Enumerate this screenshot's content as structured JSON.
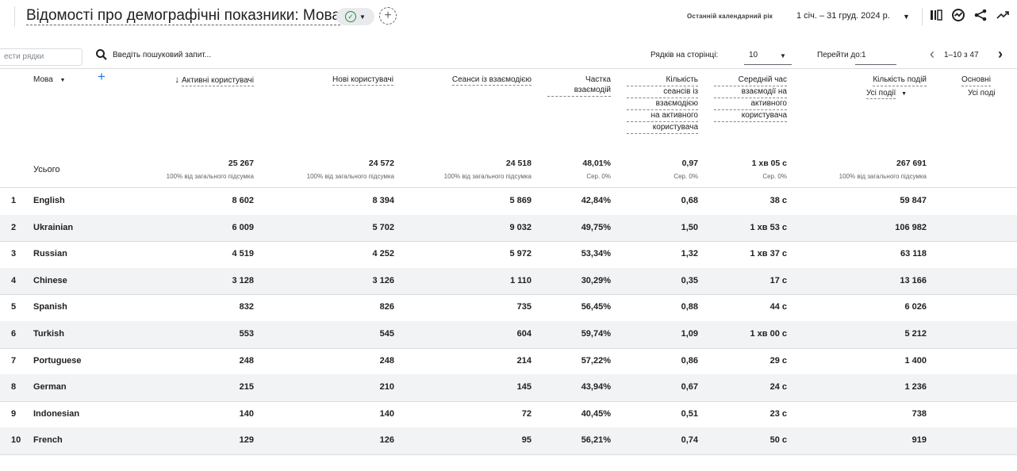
{
  "header": {
    "title": "Відомості про демографічні показники: Мова",
    "date_range_label": "Останній календарний рік",
    "date_range": "1 січ. – 31 груд. 2024 р."
  },
  "toolbar": {
    "filter_placeholder": "ести рядки",
    "search_placeholder": "Введіть пошуковий запит...",
    "rows_per_page_label": "Рядків на сторінці:",
    "rows_per_page_value": "10",
    "goto_label": "Перейти до:",
    "goto_value": "1",
    "pagination": "1–10 з 47"
  },
  "table": {
    "dimension_header": "Мова",
    "columns": [
      {
        "label": "Активні користувачі",
        "sorted": "desc"
      },
      {
        "label": "Нові користувачі"
      },
      {
        "label": "Сеанси із взаємодією"
      },
      {
        "label": "Частка взаємодій"
      },
      {
        "label": "Кількість сеансів із взаємодією на активного користувача"
      },
      {
        "label": "Середній час взаємодії на активного користувача"
      },
      {
        "label": "Кількість подій",
        "sub": "Усі події"
      },
      {
        "label": "Основні",
        "sub": "Усі поді"
      }
    ],
    "header_lines": {
      "c4": [
        "Частка",
        "взаємодій"
      ],
      "c5": [
        "Кількість",
        "сеансів із",
        "взаємодією",
        "на активного",
        "користувача"
      ],
      "c6": [
        "Середній час",
        "взаємодії на",
        "активного",
        "користувача"
      ],
      "c8": [
        "Основні"
      ]
    },
    "totals": {
      "label": "Усього",
      "values": [
        "25 267",
        "24 572",
        "24 518",
        "48,01%",
        "0,97",
        "1 хв 05 с",
        "267 691"
      ],
      "subs": [
        "100% від загального підсумка",
        "100% від загального підсумка",
        "100% від загального підсумка",
        "Сер. 0%",
        "Сер. 0%",
        "Сер. 0%",
        "100% від загального підсумка"
      ]
    },
    "rows": [
      {
        "idx": "1",
        "name": "English",
        "v": [
          "8 602",
          "8 394",
          "5 869",
          "42,84%",
          "0,68",
          "38 с",
          "59 847"
        ]
      },
      {
        "idx": "2",
        "name": "Ukrainian",
        "v": [
          "6 009",
          "5 702",
          "9 032",
          "49,75%",
          "1,50",
          "1 хв 53 с",
          "106 982"
        ]
      },
      {
        "idx": "3",
        "name": "Russian",
        "v": [
          "4 519",
          "4 252",
          "5 972",
          "53,34%",
          "1,32",
          "1 хв 37 с",
          "63 118"
        ]
      },
      {
        "idx": "4",
        "name": "Chinese",
        "v": [
          "3 128",
          "3 126",
          "1 110",
          "30,29%",
          "0,35",
          "17 с",
          "13 166"
        ]
      },
      {
        "idx": "5",
        "name": "Spanish",
        "v": [
          "832",
          "826",
          "735",
          "56,45%",
          "0,88",
          "44 с",
          "6 026"
        ]
      },
      {
        "idx": "6",
        "name": "Turkish",
        "v": [
          "553",
          "545",
          "604",
          "59,74%",
          "1,09",
          "1 хв 00 с",
          "5 212"
        ]
      },
      {
        "idx": "7",
        "name": "Portuguese",
        "v": [
          "248",
          "248",
          "214",
          "57,22%",
          "0,86",
          "29 с",
          "1 400"
        ]
      },
      {
        "idx": "8",
        "name": "German",
        "v": [
          "215",
          "210",
          "145",
          "43,94%",
          "0,67",
          "24 с",
          "1 236"
        ]
      },
      {
        "idx": "9",
        "name": "Indonesian",
        "v": [
          "140",
          "140",
          "72",
          "40,45%",
          "0,51",
          "23 с",
          "738"
        ]
      },
      {
        "idx": "10",
        "name": "French",
        "v": [
          "129",
          "126",
          "95",
          "56,21%",
          "0,74",
          "50 с",
          "919"
        ]
      }
    ]
  },
  "colors": {
    "accent": "#1a73e8",
    "check": "#1e8e3e",
    "row_alt": "#f1f3f4"
  },
  "icons": [
    "add-circle-icon",
    "check-circle-icon",
    "compare-icon",
    "insights-icon",
    "share-icon",
    "trend-icon",
    "search-icon",
    "chevron-left-icon",
    "chevron-right-icon",
    "caret-down-icon",
    "plus-icon",
    "arrow-down-icon"
  ]
}
